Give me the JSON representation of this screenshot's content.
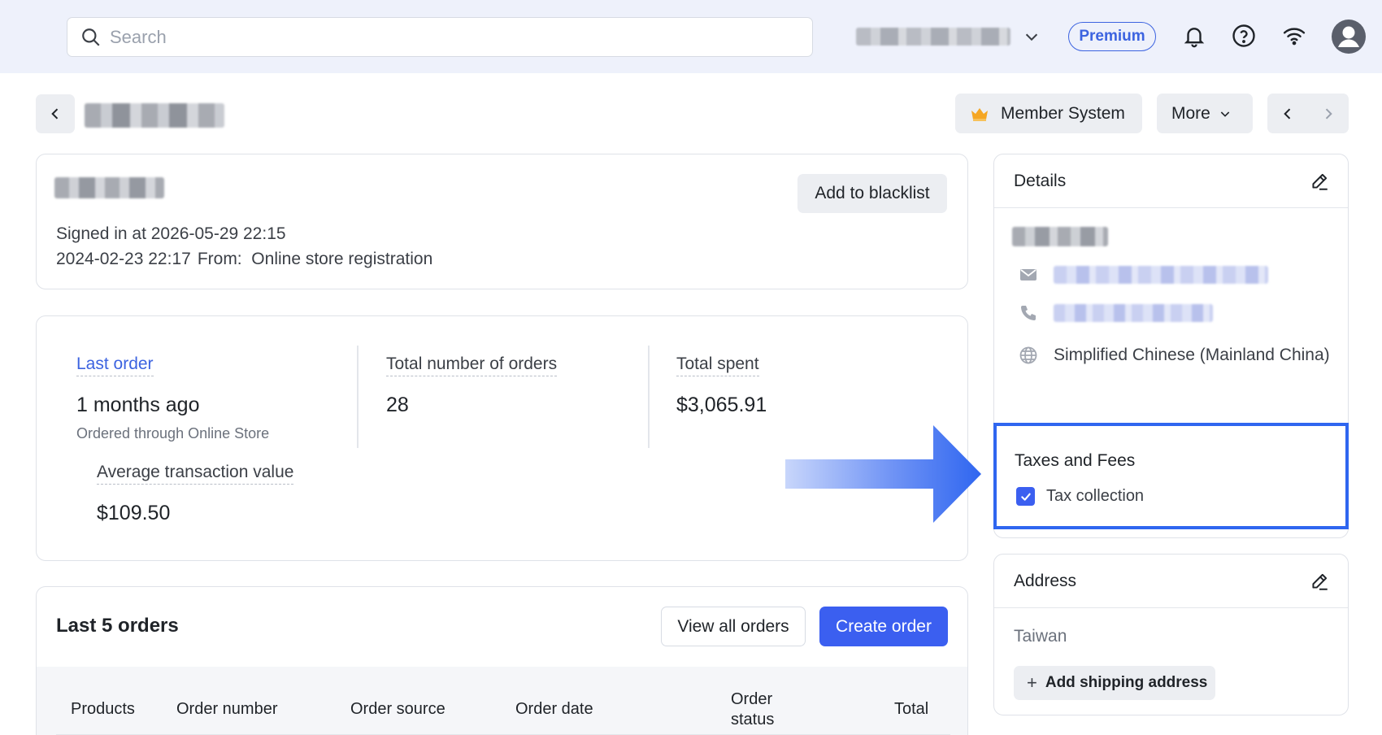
{
  "search": {
    "placeholder": "Search"
  },
  "topbar": {
    "premium_label": "Premium"
  },
  "header": {
    "member_system_label": "Member System",
    "more_label": "More"
  },
  "customer": {
    "blacklist_label": "Add to blacklist",
    "signed_in": "Signed in at 2026-05-29 22:15",
    "created_date": "2024-02-23 22:17",
    "source": "From:  Online store registration"
  },
  "stats": {
    "last_order_label": "Last order",
    "last_order_value": "1 months ago",
    "last_order_sub": "Ordered through Online Store",
    "total_orders_label": "Total number of orders",
    "total_orders_value": "28",
    "total_spent_label": "Total spent",
    "total_spent_value": "$3,065.91",
    "avg_label": "Average transaction value",
    "avg_value": "$109.50"
  },
  "orders": {
    "title": "Last 5 orders",
    "view_all_label": "View all orders",
    "create_label": "Create order",
    "columns": [
      "Products",
      "Order number",
      "Order source",
      "Order date",
      "Order status",
      "Total"
    ]
  },
  "details": {
    "title": "Details",
    "language": "Simplified Chinese (Mainland China)"
  },
  "taxes": {
    "title": "Taxes and Fees",
    "tax_collection_label": "Tax collection",
    "tax_collection_checked": true
  },
  "address": {
    "title": "Address",
    "country": "Taiwan",
    "add_shipping_label": "Add shipping address"
  },
  "colors": {
    "accent": "#3b5ff0",
    "highlight_border": "#2f66f0",
    "topbar_bg": "#eef1fb"
  },
  "icons": [
    "search-icon",
    "chevron-down-icon",
    "bell-icon",
    "help-icon",
    "wifi-icon",
    "user-avatar-icon",
    "chevron-left-icon",
    "chevron-right-icon",
    "crown-icon",
    "edit-icon",
    "mail-icon",
    "phone-icon",
    "globe-icon",
    "check-icon",
    "plus-icon",
    "arrow-right-icon"
  ]
}
